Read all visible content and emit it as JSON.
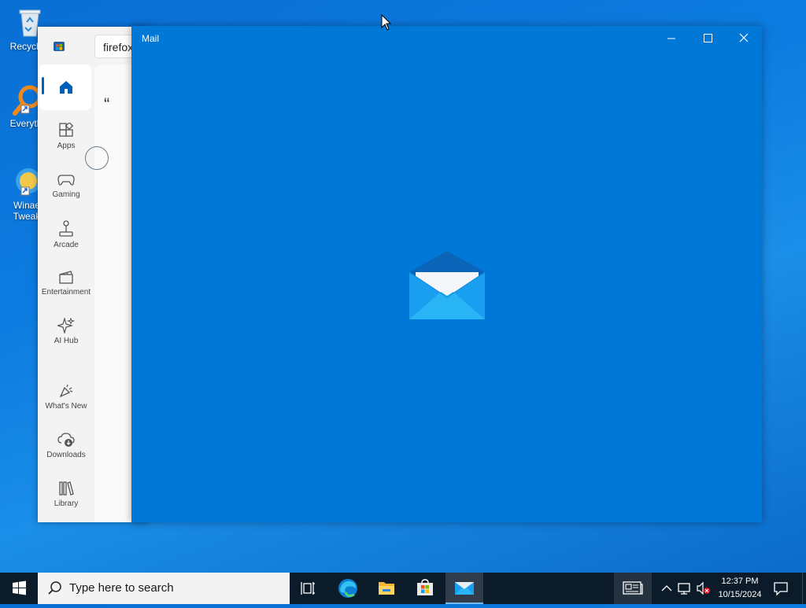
{
  "desktop": {
    "icons": [
      {
        "label": "Recycle"
      },
      {
        "label": "Everyth"
      },
      {
        "label": "Winae",
        "label2": "Tweak"
      }
    ]
  },
  "store": {
    "search_value": "firefox",
    "content_quote": "“",
    "nav": [
      {
        "label": "Apps"
      },
      {
        "label": "Gaming"
      },
      {
        "label": "Arcade"
      },
      {
        "label": "Entertainment"
      },
      {
        "label": "AI Hub"
      },
      {
        "label": "What's New"
      },
      {
        "label": "Downloads"
      },
      {
        "label": "Library"
      }
    ]
  },
  "mail": {
    "title": "Mail",
    "accent": "#0078d7"
  },
  "taskbar": {
    "search_placeholder": "Type here to search",
    "time": "12:37 PM",
    "date": "10/15/2024"
  }
}
